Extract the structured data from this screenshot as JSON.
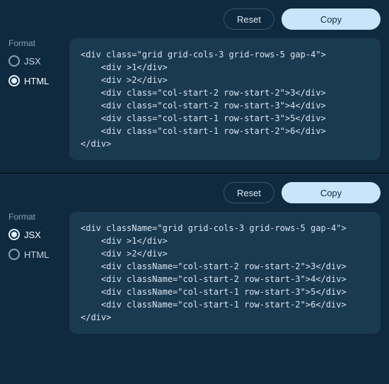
{
  "buttons": {
    "reset": "Reset",
    "copy": "Copy"
  },
  "format_label": "Format",
  "format_options": {
    "jsx": "JSX",
    "html": "HTML"
  },
  "panels": [
    {
      "selected": "html",
      "code": "<div class=\"grid grid-cols-3 grid-rows-5 gap-4\">\n    <div >1</div>\n    <div >2</div>\n    <div class=\"col-start-2 row-start-2\">3</div>\n    <div class=\"col-start-2 row-start-3\">4</div>\n    <div class=\"col-start-1 row-start-3\">5</div>\n    <div class=\"col-start-1 row-start-2\">6</div>\n</div>"
    },
    {
      "selected": "jsx",
      "code": "<div className=\"grid grid-cols-3 grid-rows-5 gap-4\">\n    <div >1</div>\n    <div >2</div>\n    <div className=\"col-start-2 row-start-2\">3</div>\n    <div className=\"col-start-2 row-start-3\">4</div>\n    <div className=\"col-start-1 row-start-3\">5</div>\n    <div className=\"col-start-1 row-start-2\">6</div>\n</div>"
    }
  ]
}
